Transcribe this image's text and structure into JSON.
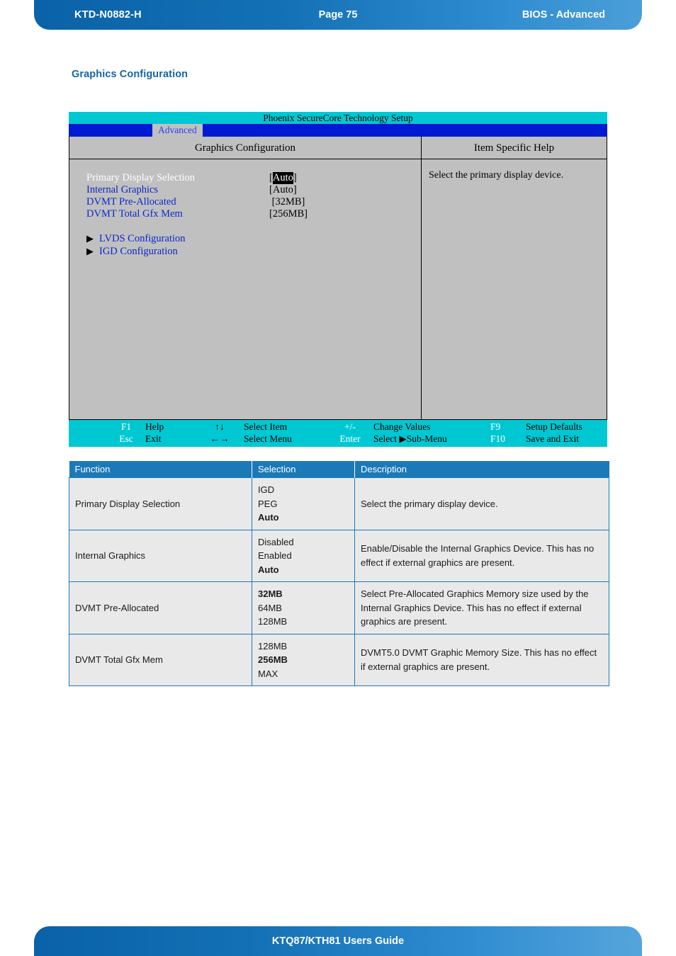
{
  "header": {
    "left": "KTD-N0882-H",
    "center": "Page 75",
    "right": "BIOS  - Advanced"
  },
  "section": {
    "heading": "Graphics Configuration"
  },
  "bios": {
    "title": "Phoenix SecureCore Technology Setup",
    "tab": "Advanced",
    "left_column_header": "Graphics Configuration",
    "right_column_header": "Item Specific Help",
    "help_text": "Select the primary display device.",
    "settings": [
      {
        "label": "Primary Display Selection",
        "value": "Auto",
        "selected": true
      },
      {
        "label": "Internal Graphics",
        "value": "Auto",
        "selected": false
      },
      {
        "label": "DVMT Pre-Allocated",
        "value": "32MB",
        "selected": false
      },
      {
        "label": "DVMT Total Gfx Mem",
        "value": "256MB",
        "selected": false
      }
    ],
    "submenus": [
      {
        "arrow": "▶",
        "label": "LVDS Configuration"
      },
      {
        "arrow": "▶",
        "label": "IGD Configuration"
      }
    ],
    "footer": {
      "row1": {
        "key": "F1",
        "action": "Help",
        "nav_key": "↑↓",
        "nav_action": "Select Item",
        "pm_key": "+/-",
        "pm_action": "Change Values",
        "f9_key": "F9",
        "f9_action": "Setup Defaults"
      },
      "row2": {
        "key": "Esc",
        "action": "Exit",
        "nav_key": "←→",
        "nav_action": "Select Menu",
        "pm_key": "Enter",
        "pm_action": "Select ▶Sub-Menu",
        "f9_key": "F10",
        "f9_action": "Save and Exit"
      }
    }
  },
  "table": {
    "columns": [
      "Function",
      "Selection",
      "Description"
    ],
    "rows": [
      {
        "function": "Primary Display Selection",
        "selection": [
          {
            "text": "IGD",
            "bold": false
          },
          {
            "text": "PEG",
            "bold": false
          },
          {
            "text": "Auto",
            "bold": true
          }
        ],
        "description": "Select the primary display device."
      },
      {
        "function": "Internal Graphics",
        "selection": [
          {
            "text": "Disabled",
            "bold": false
          },
          {
            "text": "Enabled",
            "bold": false
          },
          {
            "text": "Auto",
            "bold": true
          }
        ],
        "description": "Enable/Disable the Internal Graphics Device. This has no effect if external graphics are present."
      },
      {
        "function": "DVMT Pre-Allocated",
        "selection": [
          {
            "text": "32MB",
            "bold": true
          },
          {
            "text": "64MB",
            "bold": false
          },
          {
            "text": "128MB",
            "bold": false
          }
        ],
        "description": "Select Pre-Allocated Graphics Memory size used by the Internal Graphics Device. This has no effect if external graphics are present."
      },
      {
        "function": "DVMT Total Gfx Mem",
        "selection": [
          {
            "text": "128MB",
            "bold": false
          },
          {
            "text": "256MB",
            "bold": true
          },
          {
            "text": "MAX",
            "bold": false
          }
        ],
        "description": "DVMT5.0 DVMT Graphic Memory Size. This has no effect if external graphics are present."
      }
    ]
  },
  "footer": {
    "text": "KTQ87/KTH81 Users Guide"
  },
  "colors": {
    "brand_blue": "#1b79b8",
    "heading_blue": "#1464a5",
    "bios_cyan": "#00c8d2",
    "bios_menu_blue": "#0019d2",
    "bios_gray": "#c0c0c0",
    "table_row_bg": "#e9e9e9"
  }
}
